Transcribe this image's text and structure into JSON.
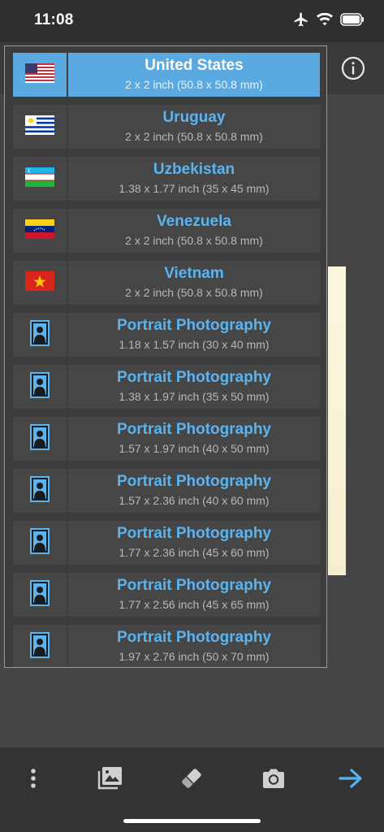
{
  "status_bar": {
    "time": "11:08"
  },
  "countries": [
    {
      "title": "United States",
      "size": "2 x 2 inch (50.8 x 50.8 mm)",
      "icon": "us-flag-icon",
      "selected": true
    },
    {
      "title": "Uruguay",
      "size": "2 x 2 inch (50.8 x 50.8 mm)",
      "icon": "uruguay-flag-icon"
    },
    {
      "title": "Uzbekistan",
      "size": "1.38 x 1.77 inch (35 x 45 mm)",
      "icon": "uzbekistan-flag-icon"
    },
    {
      "title": "Venezuela",
      "size": "2 x 2 inch (50.8 x 50.8 mm)",
      "icon": "venezuela-flag-icon"
    },
    {
      "title": "Vietnam",
      "size": "2 x 2 inch (50.8 x 50.8 mm)",
      "icon": "vietnam-flag-icon"
    },
    {
      "title": "Portrait Photography",
      "size": "1.18 x 1.57 inch (30 x 40 mm)",
      "icon": "portrait-icon"
    },
    {
      "title": "Portrait Photography",
      "size": "1.38 x 1.97 inch (35 x 50 mm)",
      "icon": "portrait-icon"
    },
    {
      "title": "Portrait Photography",
      "size": "1.57 x 1.97 inch (40 x 50 mm)",
      "icon": "portrait-icon"
    },
    {
      "title": "Portrait Photography",
      "size": "1.57 x 2.36 inch (40 x 60 mm)",
      "icon": "portrait-icon"
    },
    {
      "title": "Portrait Photography",
      "size": "1.77 x 2.36 inch (45 x 60 mm)",
      "icon": "portrait-icon"
    },
    {
      "title": "Portrait Photography",
      "size": "1.77 x 2.56 inch (45 x 65 mm)",
      "icon": "portrait-icon"
    },
    {
      "title": "Portrait Photography",
      "size": "1.97 x 2.76 inch (50 x 70 mm)",
      "icon": "portrait-icon"
    }
  ],
  "toolbar": {
    "items": [
      "more-icon",
      "gallery-icon",
      "eraser-icon",
      "camera-icon",
      "next-arrow-icon"
    ]
  },
  "colors": {
    "accent": "#5ab4f2",
    "selected_row": "#5aa9e0",
    "row_bg": "#464646",
    "toolbar_bg": "#333333"
  }
}
